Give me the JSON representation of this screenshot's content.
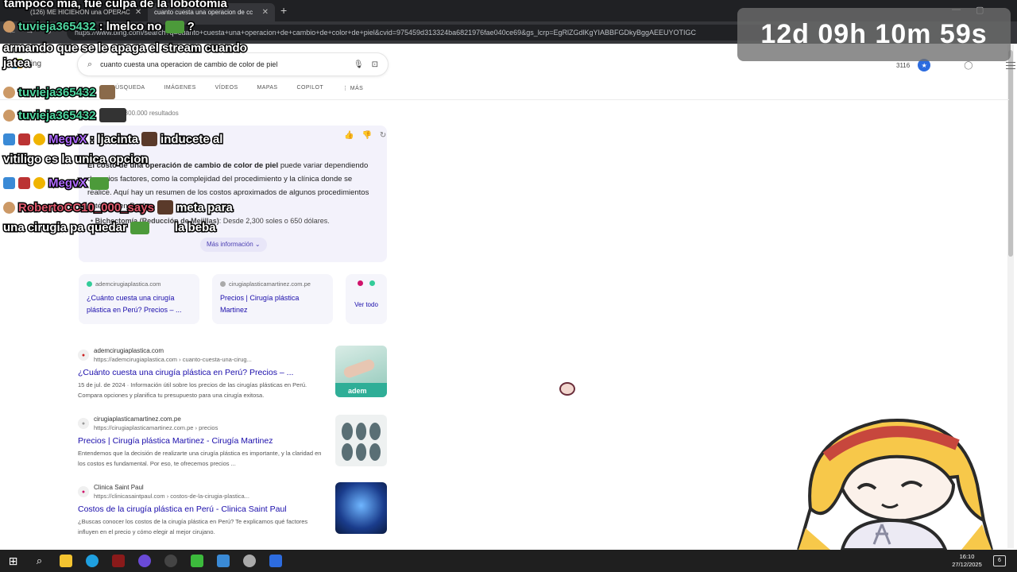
{
  "browser": {
    "tabs": [
      {
        "label": "(126) ME HICIERON una OPERAC"
      },
      {
        "label": "cuanto cuesta una operacion de cc"
      }
    ],
    "url": "https://www.bing.com/search?q=cuanto+cuesta+una+operacion+de+cambio+de+color+de+piel&cvid=975459d313324ba6821976fae040ce69&gs_lcrp=EgRlZGdlKgYIABBFGDkyBggAEEUYOTIGC"
  },
  "bing": {
    "logo": "Bing",
    "query": "cuanto cuesta una operacion de cambio de color de piel",
    "nav": [
      "BÚSQUEDA",
      "IMÁGENES",
      "VÍDEOS",
      "MAPAS",
      "COPILOT",
      "⋮ MÁS"
    ],
    "result_count": "2.300.000 resultados",
    "points": "3116",
    "ai": {
      "bold": "El costo de una operación de cambio de color de piel",
      "text": " puede variar dependiendo de varios factores, como la complejidad del procedimiento y la clínica donde se realice. Aquí hay un resumen de los costos aproximados de algunos procedimientos estéticos en Perú:",
      "bullet_bold": "Bichectomía (Reducción de Mejillas)",
      "bullet_text": ": Desde 2,300 soles o 650 dólares.",
      "more": "Más información"
    },
    "sources": [
      {
        "domain": "ademcirugiaplastica.com",
        "title": "¿Cuánto cuesta una cirugía plástica en Perú? Precios – ..."
      },
      {
        "domain": "cirugiaplasticamartinez.com.pe",
        "title": "Precios | Cirugía plástica Martinez"
      }
    ],
    "see_all": "Ver todo",
    "results": [
      {
        "site": "ademcirugiaplastica.com",
        "path": "https://ademcirugiaplastica.com › cuanto-cuesta-una-cirug...",
        "title": "¿Cuánto cuesta una cirugía plástica en Perú? Precios – ...",
        "snippet": "15 de jul. de 2024 · Información útil sobre los precios de las cirugías plásticas en Perú. Compara opciones y planifica tu presupuesto para una cirugía exitosa.",
        "thumb_label": "adem"
      },
      {
        "site": "cirugiaplasticamartinez.com.pe",
        "path": "https://cirugiaplasticamartinez.com.pe › precios",
        "title": "Precios | Cirugía plástica Martinez - Cirugía Martinez",
        "snippet": "Entendemos que la decisión de realizarte una cirugía plástica es importante, y la claridad en los costos es fundamental. Por eso, te ofrecemos precios ..."
      },
      {
        "site": "Clinica Saint Paul",
        "path": "https://clinicasaintpaul.com › costos-de-la-cirugia-plastica...",
        "title": "Costos de la cirugía plástica en Perú - Clinica Saint Paul",
        "snippet": "¿Buscas conocer los costos de la cirugía plástica en Perú? Te explicamos qué factores influyen en el precio y cómo elegir al mejor cirujano."
      }
    ]
  },
  "overlay": {
    "stream_title": "tampoco mia, fue culpa de la lobotomia",
    "timer": "12d 09h 10m 59s",
    "chat": [
      {
        "user": "tuvieja365432",
        "sep": ": ",
        "msg": "lmelco no"
      },
      {
        "user": "",
        "sep": "",
        "msg": "armando que se le apaga el stream cuando jatea"
      },
      {
        "user": "tuvieja365432",
        "sep": "",
        "msg": ""
      },
      {
        "user": "tuvieja365432",
        "sep": "",
        "msg": ""
      },
      {
        "user": "MegvX",
        "sep": ": ",
        "msg": "ljacinta",
        "msg2": "inducete al"
      },
      {
        "user": "",
        "sep": "",
        "msg": "vitiligo es la unica opcion"
      },
      {
        "user": "MegvX",
        "sep": "",
        "msg": ""
      },
      {
        "user": "RobertoCC10_000_says",
        "sep": "",
        "msg": "meta para"
      },
      {
        "user": "",
        "sep": "",
        "msg": "una cirugia pa quedar",
        "msg2": "la beba"
      }
    ]
  },
  "taskbar": {
    "time": "16:10",
    "date": "27/12/2025",
    "notifications": "6"
  }
}
